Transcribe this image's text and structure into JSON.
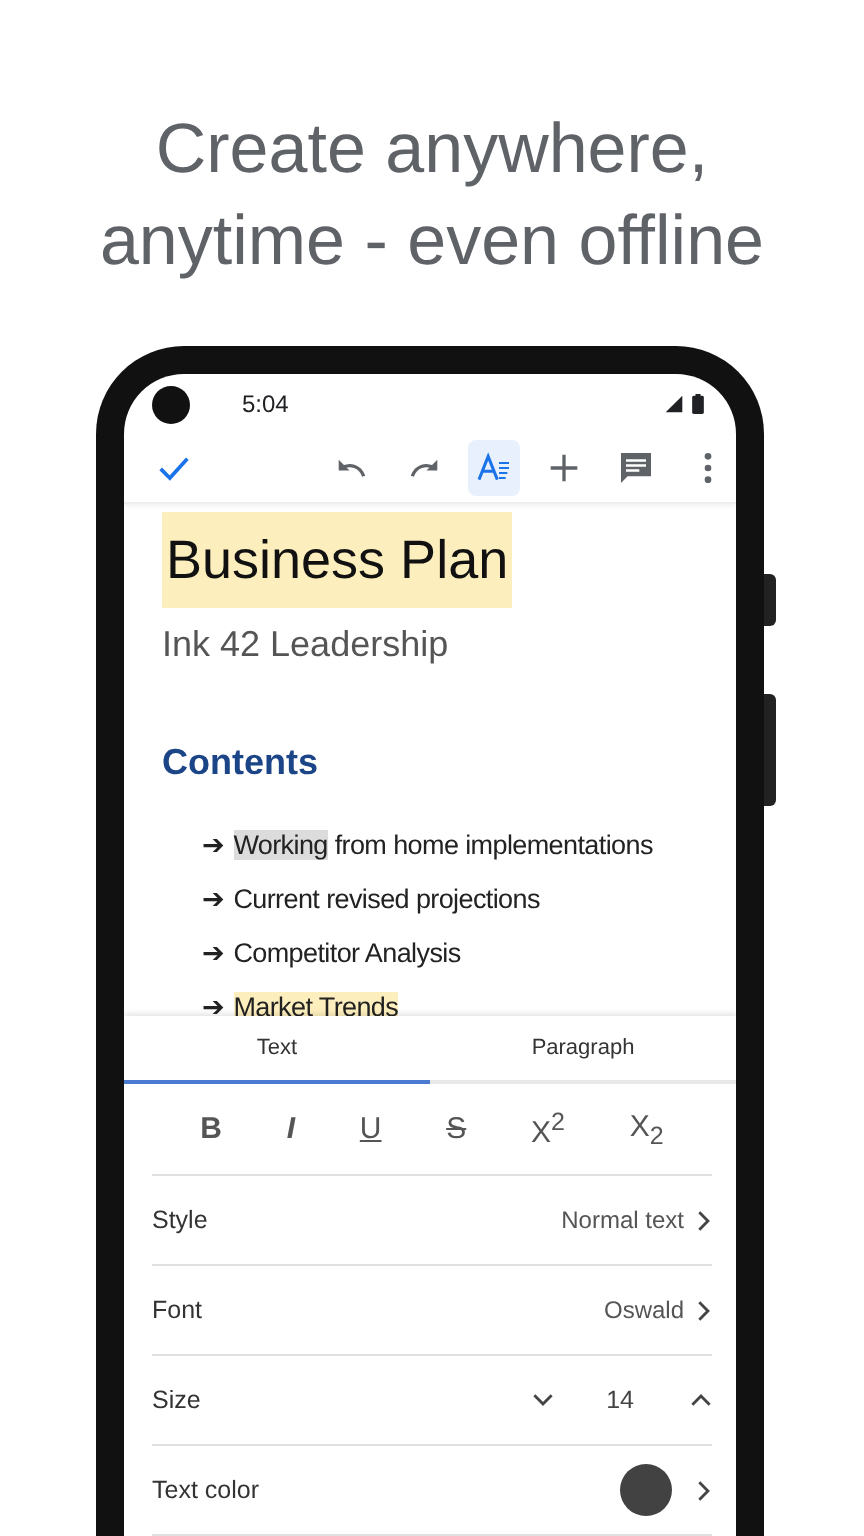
{
  "headline": [
    "Create anywhere,",
    "anytime - even offline"
  ],
  "status_bar": {
    "time": "5:04"
  },
  "toolbar": [
    {
      "kind": "done",
      "selected": false
    },
    {
      "kind": "undo",
      "selected": false
    },
    {
      "kind": "redo",
      "selected": false
    },
    {
      "kind": "format",
      "selected": true
    },
    {
      "kind": "insert",
      "selected": false
    },
    {
      "kind": "comment",
      "selected": false
    },
    {
      "kind": "more",
      "selected": false
    }
  ],
  "document": {
    "title": "Business Plan",
    "title_highlighted": true,
    "subtitle": "Ink 42 Leadership",
    "heading": "Contents",
    "items": [
      {
        "bullet": "➔",
        "parts": [
          {
            "text": "Working",
            "color": "#dcdcdc"
          },
          {
            "text": " from home implementations"
          }
        ]
      },
      {
        "bullet": "➔",
        "parts": [
          {
            "text": "Current revised projections"
          }
        ]
      },
      {
        "bullet": "➔",
        "parts": [
          {
            "text": "Competitor Analysis"
          }
        ]
      },
      {
        "bullet": "➔",
        "parts": [
          {
            "text": "Market Trends",
            "color": "#fdefbd"
          }
        ]
      }
    ]
  },
  "panel": {
    "tabs": [
      {
        "label": "Text",
        "selected": true
      },
      {
        "label": "Paragraph",
        "selected": false
      }
    ],
    "format_buttons": [
      {
        "kind": "bold",
        "label": "B"
      },
      {
        "kind": "italic",
        "label": "I"
      },
      {
        "kind": "underline",
        "label": "U"
      },
      {
        "kind": "strike",
        "label": "S"
      },
      {
        "kind": "superscript",
        "label": "X$^{2}$"
      },
      {
        "kind": "subscript",
        "label": "X$_{2}$"
      }
    ],
    "rows": [
      {
        "kind": "link",
        "label": "Style",
        "value": "Normal text"
      },
      {
        "kind": "link",
        "label": "Font",
        "value": "Oswald"
      },
      {
        "kind": "stepper",
        "label": "Size",
        "value": "14"
      },
      {
        "kind": "color",
        "label": "Text color",
        "color": "#424242"
      }
    ]
  }
}
